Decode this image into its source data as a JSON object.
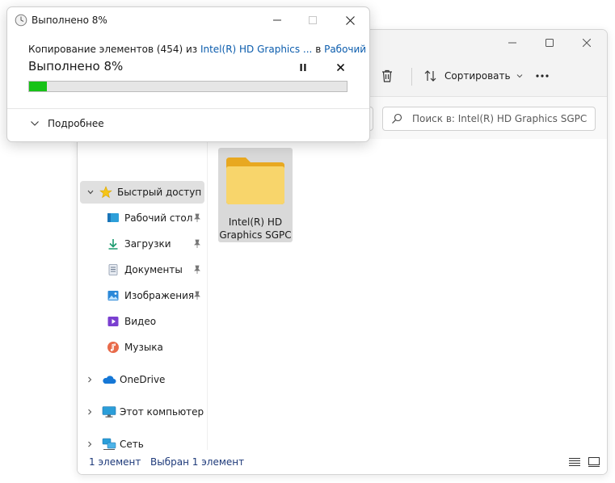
{
  "colors": {
    "progress_fill": "#16c216",
    "link": "#0b5cad",
    "status_text": "#1e3a7a",
    "folder": "#f6c64a",
    "selection": "#d9d9d9"
  },
  "dialog": {
    "title": "Выполнено 8%",
    "message": {
      "prefix": "Копирование элементов (454) из ",
      "source": "Intel(R) HD Graphics ...",
      "middle": " в ",
      "destination": "Рабочий стол"
    },
    "percent_text": "Выполнено 8%",
    "progress": 0.055,
    "details_label": "Подробнее",
    "icons": [
      "clock-icon",
      "minimize-icon",
      "maximize-icon",
      "close-icon",
      "pause-icon",
      "cancel-icon",
      "chevron-down-icon"
    ]
  },
  "toolbar": {
    "sort_label": "Сортировать",
    "icons": [
      "delete-icon",
      "sort-icon",
      "more-icon"
    ]
  },
  "search": {
    "placeholder": "Поиск в: Intel(R) HD Graphics SGPC"
  },
  "sidebar": {
    "quick_access": "Быстрый доступ",
    "items": [
      {
        "label": "Рабочий стол",
        "icon": "desktop-icon",
        "pinned": true
      },
      {
        "label": "Загрузки",
        "icon": "downloads-icon",
        "pinned": true
      },
      {
        "label": "Документы",
        "icon": "documents-icon",
        "pinned": true
      },
      {
        "label": "Изображения",
        "icon": "pictures-icon",
        "pinned": true
      },
      {
        "label": "Видео",
        "icon": "videos-icon",
        "pinned": false
      },
      {
        "label": "Музыка",
        "icon": "music-icon",
        "pinned": false
      }
    ],
    "roots": [
      {
        "label": "OneDrive",
        "icon": "cloud-icon"
      },
      {
        "label": "Этот компьютер",
        "icon": "computer-icon"
      },
      {
        "label": "Сеть",
        "icon": "network-icon"
      }
    ]
  },
  "files": [
    {
      "name": "Intel(R) HD Graphics SGPC",
      "type": "folder",
      "selected": true
    }
  ],
  "status": {
    "count": "1 элемент",
    "selected": "Выбран 1 элемент"
  }
}
